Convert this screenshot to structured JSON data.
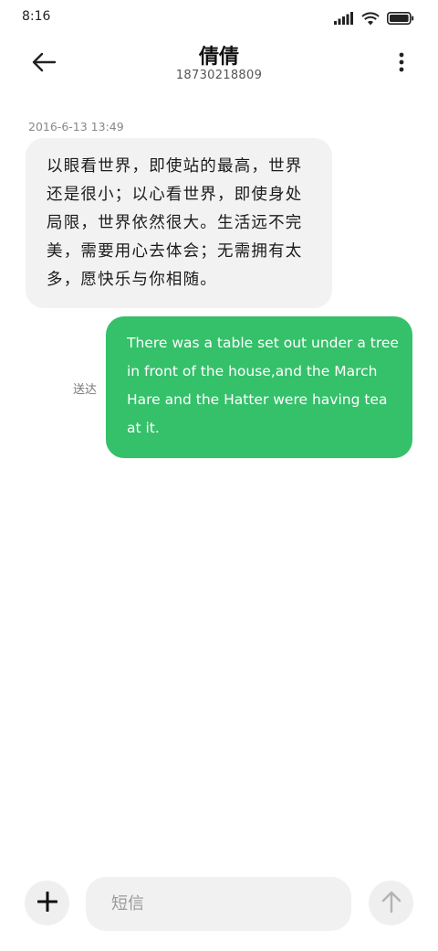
{
  "status_bar": {
    "time": "8:16",
    "icons": [
      "signal-icon",
      "wifi-icon",
      "battery-icon"
    ]
  },
  "header": {
    "back_icon": "arrow-left-icon",
    "contact_name": "倩倩",
    "contact_number": "18730218809",
    "more_icon": "more-vertical-icon"
  },
  "messages": [
    {
      "direction": "incoming",
      "timestamp": "2016-6-13 13:49",
      "text": "以眼看世界，即使站的最高，世界还是很小；以心看世界，即使身处局限，世界依然很大。生活远不完美，需要用心去体会；无需拥有太多，愿快乐与你相随。"
    },
    {
      "direction": "outgoing",
      "status": "送达",
      "text": "There was a table set out under a tree in front of the house,and the March Hare and the Hatter were having tea at it."
    }
  ],
  "composer": {
    "attach_icon": "plus-icon",
    "placeholder": "短信",
    "value": "",
    "send_icon": "arrow-up-icon"
  },
  "colors": {
    "outgoing_bubble": "#35c06a",
    "incoming_bubble": "#f2f2f2",
    "background": "#ffffff"
  }
}
